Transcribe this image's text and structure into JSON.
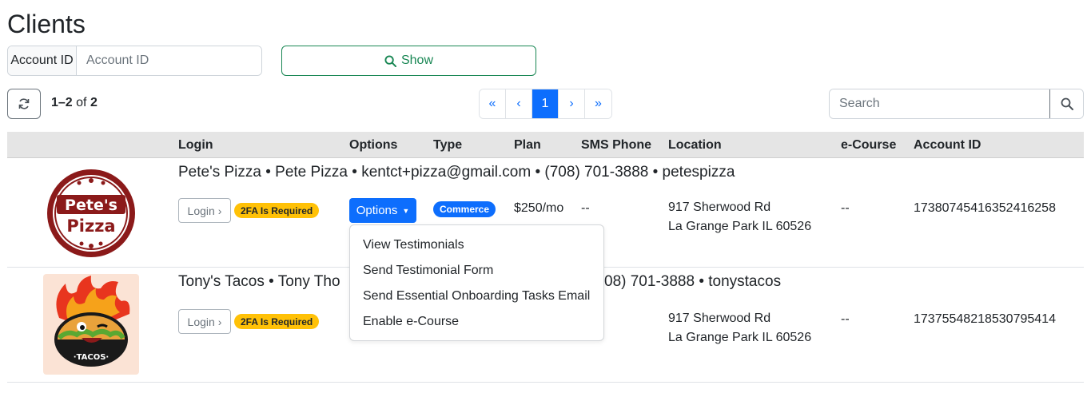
{
  "page": {
    "title": "Clients"
  },
  "account_filter": {
    "addon_label": "Account ID",
    "placeholder": "Account ID"
  },
  "show_button": {
    "label": "Show"
  },
  "result_count": {
    "range": "1–2",
    "of_word": "of",
    "total": "2"
  },
  "pagination": {
    "first": "«",
    "prev": "‹",
    "current": "1",
    "next": "›",
    "last": "»"
  },
  "search": {
    "placeholder": "Search"
  },
  "table": {
    "columns": [
      "Login",
      "Options",
      "Type",
      "Plan",
      "SMS Phone",
      "Location",
      "e-Course",
      "Account ID"
    ],
    "rows": [
      {
        "header": "Pete's Pizza • Pete Pizza • kentct+pizza@gmail.com • (708) 701-3888 • petespizza",
        "logo_text": [
          "Pete's",
          "Pizza"
        ],
        "login_label": "Login",
        "twofa_label": "2FA Is Required",
        "options_label": "Options",
        "type": "Commerce",
        "plan": "$250/mo",
        "sms_phone": "--",
        "location_line1": "917 Sherwood Rd",
        "location_line2": "La Grange Park IL 60526",
        "ecourse": "--",
        "account_id": "17380745416352416258"
      },
      {
        "header_left": "Tony's Tacos • Tony Tho",
        "header_right": "08) 701-3888 • tonystacos",
        "logo_text": [
          "·TACOS·"
        ],
        "login_label": "Login",
        "twofa_label": "2FA Is Required",
        "location_line1": "917 Sherwood Rd",
        "location_line2": "La Grange Park IL 60526",
        "ecourse": "--",
        "account_id": "17375548218530795414"
      }
    ]
  },
  "options_menu": {
    "items": [
      "View Testimonials",
      "Send Testimonial Form",
      "Send Essential Onboarding Tasks Email",
      "Enable e-Course"
    ]
  },
  "colors": {
    "primary": "#0d6efd",
    "success": "#198754",
    "warning": "#ffc107",
    "pizza_red": "#8b1a1a"
  }
}
